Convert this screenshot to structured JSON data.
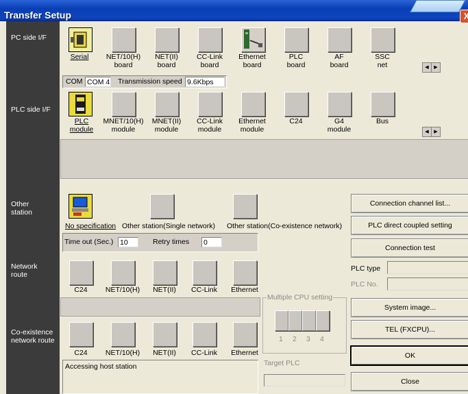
{
  "window": {
    "title": "Transfer Setup",
    "close_label": "X"
  },
  "sidebar": {
    "pc_side": "PC side I/F",
    "plc_side": "PLC side I/F",
    "other_station_1": "Other",
    "other_station_2": "station",
    "network_route_1": "Network",
    "network_route_2": "route",
    "coexist_1": "Co-existence",
    "coexist_2": "network route"
  },
  "pc_side": {
    "items": [
      {
        "line1": "Serial",
        "line2": ""
      },
      {
        "line1": "NET/10(H)",
        "line2": "board"
      },
      {
        "line1": "NET(II)",
        "line2": "board"
      },
      {
        "line1": "CC-Link",
        "line2": "board"
      },
      {
        "line1": "Ethernet",
        "line2": "board"
      },
      {
        "line1": "PLC",
        "line2": "board"
      },
      {
        "line1": "AF",
        "line2": "board"
      },
      {
        "line1": "SSC",
        "line2": "net"
      }
    ],
    "com_label": "COM",
    "com_value": "COM 4",
    "speed_label": "Transmission speed",
    "speed_value": "9.6Kbps"
  },
  "plc_side": {
    "items": [
      {
        "line1": "PLC",
        "line2": "module"
      },
      {
        "line1": "MNET/10(H)",
        "line2": "module"
      },
      {
        "line1": "MNET(II)",
        "line2": "module"
      },
      {
        "line1": "CC-Link",
        "line2": "module"
      },
      {
        "line1": "Ethernet",
        "line2": "module"
      },
      {
        "line1": "C24",
        "line2": ""
      },
      {
        "line1": "G4",
        "line2": "module"
      },
      {
        "line1": "Bus",
        "line2": ""
      }
    ]
  },
  "other_station": {
    "no_spec": "No specification",
    "single": "Other station(Single network)",
    "coexist": "Other station(Co-existence network)",
    "timeout_label": "Time out (Sec.)",
    "timeout_value": "10",
    "retry_label": "Retry times",
    "retry_value": "0"
  },
  "network_route": {
    "items": [
      "C24",
      "NET/10(H)",
      "NET(II)",
      "CC-Link",
      "Ethernet"
    ]
  },
  "coexist_route": {
    "items": [
      "C24",
      "NET/10(H)",
      "NET(II)",
      "CC-Link",
      "Ethernet"
    ],
    "status": "Accessing host station"
  },
  "multi_cpu": {
    "title": "Multiple CPU setting",
    "numbers": [
      "1",
      "2",
      "3",
      "4"
    ],
    "target_label": "Target PLC"
  },
  "plc_info": {
    "type_label": "PLC type",
    "no_label": "PLC No."
  },
  "buttons": {
    "channel_list": "Connection channel list...",
    "direct": "PLC direct coupled setting",
    "test": "Connection test",
    "system_image": "System  image...",
    "tel": "TEL (FXCPU)...",
    "ok": "OK",
    "close": "Close"
  }
}
